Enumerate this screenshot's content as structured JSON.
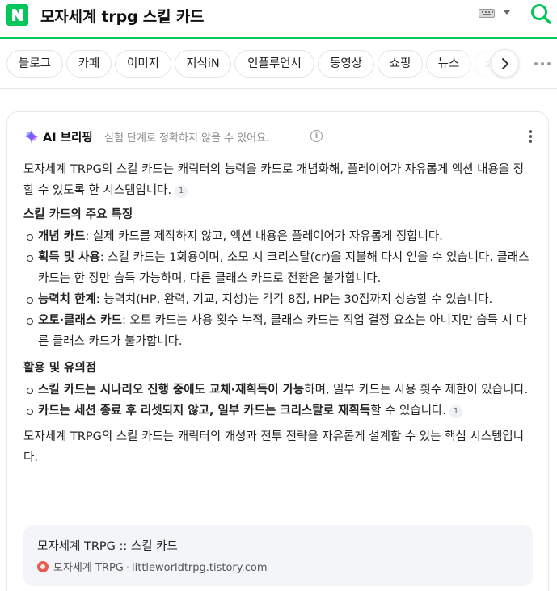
{
  "search": {
    "query": "모자세계 trpg 스킬 카드"
  },
  "tabs": [
    {
      "label": "블로그"
    },
    {
      "label": "카페"
    },
    {
      "label": "이미지"
    },
    {
      "label": "지식iN"
    },
    {
      "label": "인플루언서"
    },
    {
      "label": "동영상"
    },
    {
      "label": "쇼핑"
    },
    {
      "label": "뉴스"
    },
    {
      "label": "쇼"
    }
  ],
  "ai_briefing": {
    "title": "AI 브리핑",
    "note": "실험 단계로 정확하지 않을 수 있어요.",
    "intro": "모자세계 TRPG의 스킬 카드는 캐릭터의 능력을 카드로 개념화해, 플레이어가 자유롭게 액션 내용을 정할 수 있도록 한 시스템입니다.",
    "intro_cite": "1",
    "section1_title": "스킬 카드의 주요 특징",
    "section1_items": [
      {
        "term": "개념 카드",
        "text": ": 실제 카드를 제작하지 않고, 액션 내용은 플레이어가 자유롭게 정합니다."
      },
      {
        "term": "획득 및 사용",
        "text": ": 스킬 카드는 1회용이며, 소모 시 크리스탈(cr)을 지불해 다시 얻을 수 있습니다. 클래스 카드는 한 장만 습득 가능하며, 다른 클래스 카드로 전환은 불가합니다."
      },
      {
        "term": "능력치 한계",
        "text": ": 능력치(HP, 완력, 기교, 지성)는 각각 8점, HP는 30점까지 상승할 수 있습니다."
      },
      {
        "term": "오토·클래스 카드",
        "text": ": 오토 카드는 사용 횟수 누적, 클래스 카드는 직업 결정 요소는 아니지만 습득 시 다른 클래스 카드가 불가합니다."
      }
    ],
    "section2_title": "활용 및 유의점",
    "section2_items": [
      {
        "term": "스킬 카드는 시나리오 진행 중에도 교체·재획득이 가능",
        "text": "하며, 일부 카드는 사용 횟수 제한이 있습니다."
      },
      {
        "term": "카드는 세션 종료 후 리셋되지 않고, 일부 카드는 크리스탈로 재획득",
        "text": "할 수 있습니다.",
        "cite": "1"
      }
    ],
    "conclusion": "모자세계 TRPG의 스킬 카드는 캐릭터의 개성과 전투 전략을 자유롭게 설계할 수 있는 핵심 시스템입니다.",
    "source": {
      "title": "모자세계 TRPG :: 스킬 카드",
      "name": "모자세계 TRPG",
      "domain": "littleworldtrpg.tistory.com"
    }
  },
  "colors": {
    "brand_green": "#03c75a",
    "ai_purple": "#7b4dff",
    "source_favicon": "#ec5b52"
  },
  "icons": [
    "naver-logo-icon",
    "keyboard-icon",
    "chevron-down-icon",
    "search-icon",
    "chevron-right-icon",
    "more-dots-icon",
    "ai-sparkle-icon",
    "info-icon",
    "kebab-menu-icon",
    "favicon-icon"
  ]
}
